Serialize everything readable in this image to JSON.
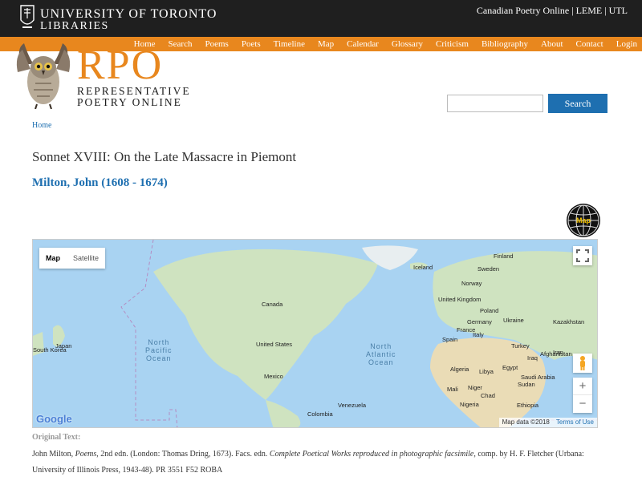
{
  "header": {
    "institution_line1": "UNIVERSITY  OF  TORONTO",
    "institution_line2": "LIBRARIES",
    "top_links": "Canadian Poetry Online | LEME | UTL"
  },
  "nav": {
    "items": [
      "Home",
      "Search",
      "Poems",
      "Poets",
      "Timeline",
      "Map",
      "Calendar",
      "Glossary",
      "Criticism",
      "Bibliography",
      "About",
      "Contact",
      "Login"
    ]
  },
  "logo": {
    "title": "RPO",
    "subtitle_line1": "REPRESENTATIVE",
    "subtitle_line2": "POETRY  ONLINE"
  },
  "search": {
    "placeholder": "",
    "button_label": "Search"
  },
  "breadcrumb": "Home",
  "poem": {
    "title": "Sonnet XVIII: On the Late Massacre in Piemont",
    "author": "Milton, John (1608 - 1674)"
  },
  "globe_label": "Map",
  "map": {
    "toggle": [
      "Map",
      "Satellite"
    ],
    "zoom_in": "+",
    "zoom_out": "−",
    "attribution": "Map data ©2018",
    "terms": "Terms of Use",
    "google": "Google",
    "labels": [
      "Finland",
      "Iceland",
      "Sweden",
      "Norway",
      "United Kingdom",
      "Poland",
      "Ukraine",
      "Kazakhstan",
      "Germany",
      "France",
      "Italy",
      "Spain",
      "Turkey",
      "Iraq",
      "Iran",
      "Afghanistan",
      "Canada",
      "United States",
      "Mexico",
      "Japan",
      "South Korea",
      "Algeria",
      "Libya",
      "Egypt",
      "Saudi Arabia",
      "Mali",
      "Niger",
      "Sudan",
      "Chad",
      "Nigeria",
      "Ethiopia",
      "Venezuela",
      "Colombia"
    ],
    "oceans": [
      {
        "line1": "North",
        "line2": "Pacific",
        "line3": "Ocean"
      },
      {
        "line1": "North",
        "line2": "Atlantic",
        "line3": "Ocean"
      }
    ]
  },
  "original": {
    "label": "Original Text:",
    "part1": "John Milton, ",
    "part2": "Poems",
    "part3": ", 2nd edn. (London: Thomas Dring, 1673). Facs. edn. ",
    "part4": "Complete Poetical Works reproduced in photographic facsimile",
    "part5": ", comp. by H. F. Fletcher (Urbana: University of Illinois Press, 1943-48). PR 3551 F52 ROBA"
  },
  "colors": {
    "topbar": "#1f1f1f",
    "accent_orange": "#e8871e",
    "link_blue": "#1e6fb0",
    "water": "#a9d3f2",
    "land": "#cfe3c0"
  }
}
